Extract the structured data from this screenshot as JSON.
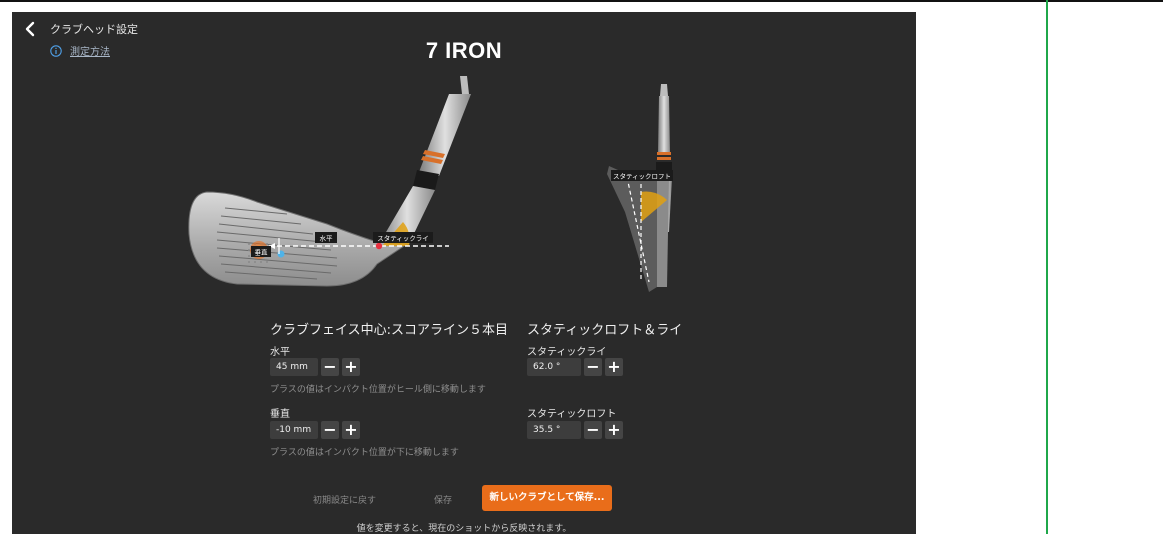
{
  "header": {
    "title": "クラブヘッド設定",
    "info_link": "測定方法",
    "club_name": "7 IRON"
  },
  "diagram": {
    "front_labels": {
      "horizontal": "水平",
      "vertical": "垂直",
      "static_lie": "スタティックライ"
    },
    "side_labels": {
      "static_loft": "スタティックロフト"
    }
  },
  "face_center": {
    "title": "クラブフェイス中心:スコアライン５本目",
    "horizontal": {
      "label": "水平",
      "value": "45 mm",
      "hint": "プラスの値はインパクト位置がヒール側に移動します"
    },
    "vertical": {
      "label": "垂直",
      "value": "-10 mm",
      "hint": "プラスの値はインパクト位置が下に移動します"
    }
  },
  "loft_lie": {
    "title": "スタティックロフト＆ライ",
    "lie": {
      "label": "スタティックライ",
      "value": "62.0 °"
    },
    "loft": {
      "label": "スタティックロフト",
      "value": "35.5 °"
    }
  },
  "controls": {
    "minus": "−",
    "plus": "+"
  },
  "footer": {
    "reset": "初期設定に戻す",
    "save": "保存",
    "save_new": "新しいクラブとして保存...",
    "note": "値を変更すると、現在のショットから反映されます。"
  },
  "colors": {
    "accent": "#e96d1a",
    "background": "#2a2a2a",
    "divider": "#1fa74a"
  }
}
